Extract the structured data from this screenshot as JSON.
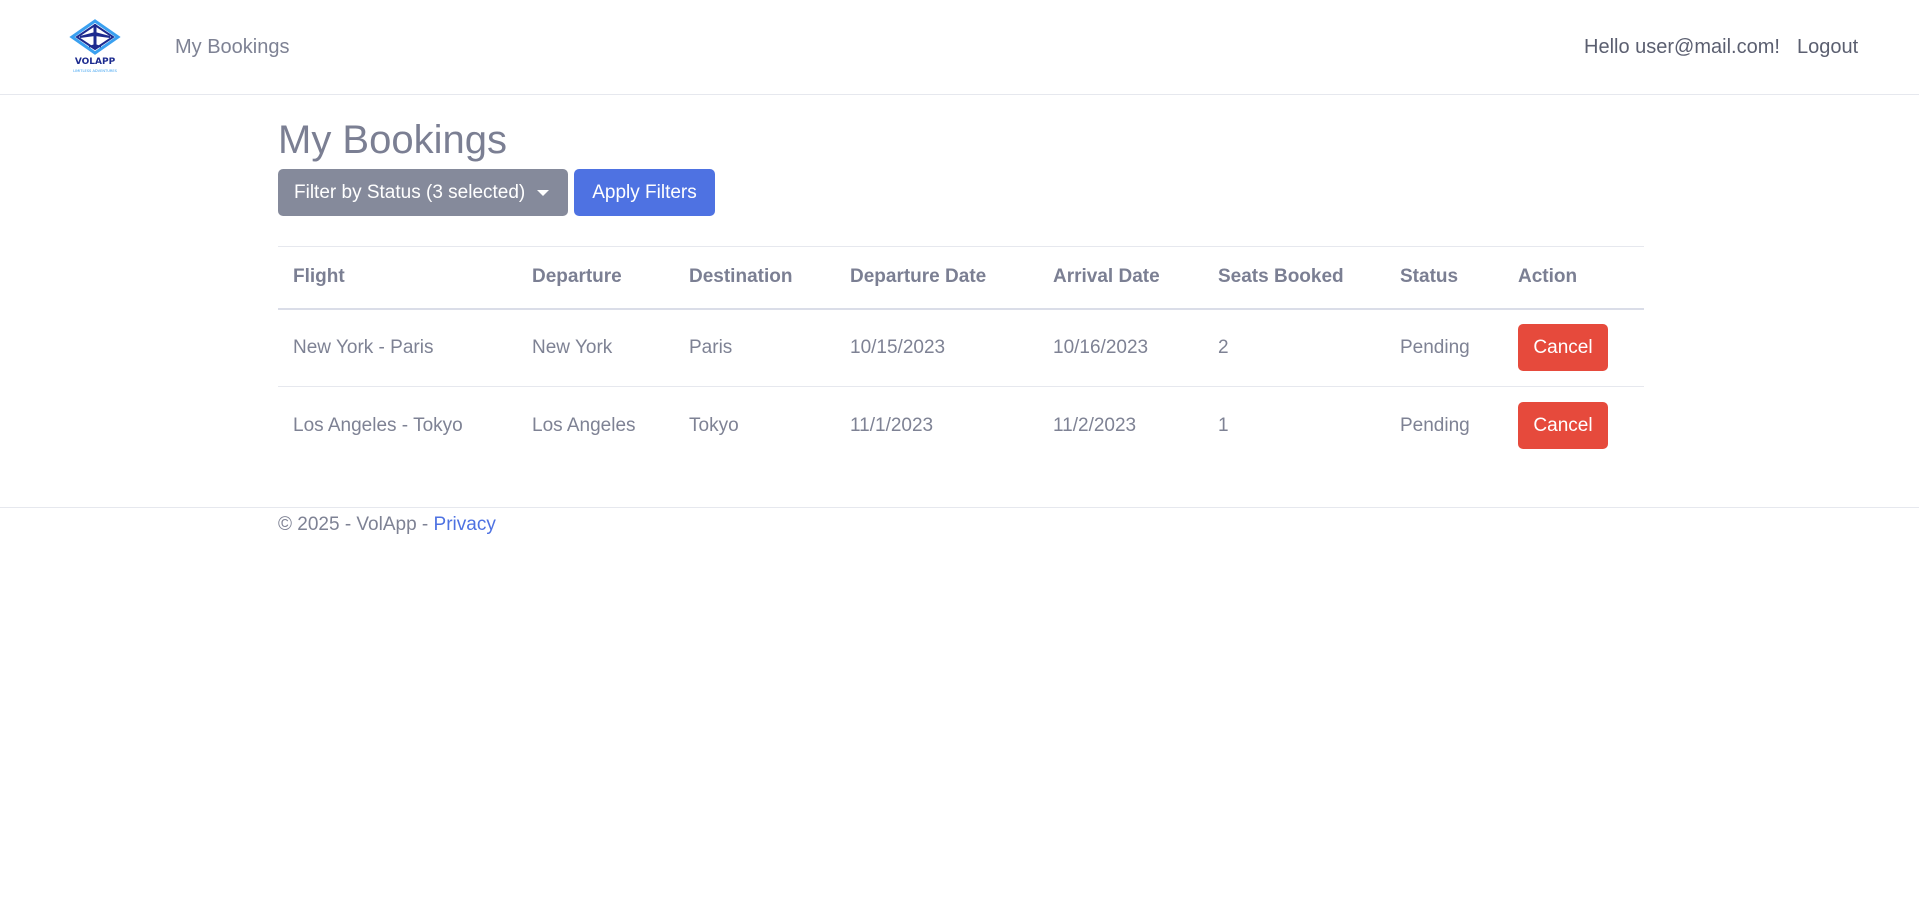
{
  "header": {
    "logo_text": "VOLAPP",
    "logo_tagline": "LIMITLESS ADVENTURES",
    "nav_my_bookings": "My Bookings",
    "greeting": "Hello user@mail.com!",
    "logout": "Logout"
  },
  "main": {
    "title": "My Bookings",
    "filter_button": "Filter by Status (3 selected)",
    "apply_button": "Apply Filters",
    "columns": [
      "Flight",
      "Departure",
      "Destination",
      "Departure Date",
      "Arrival Date",
      "Seats Booked",
      "Status",
      "Action"
    ],
    "rows": [
      {
        "flight": "New York - Paris",
        "departure": "New York",
        "destination": "Paris",
        "departure_date": "10/15/2023",
        "arrival_date": "10/16/2023",
        "seats": "2",
        "status": "Pending",
        "action": "Cancel"
      },
      {
        "flight": "Los Angeles - Tokyo",
        "departure": "Los Angeles",
        "destination": "Tokyo",
        "departure_date": "11/1/2023",
        "arrival_date": "11/2/2023",
        "seats": "1",
        "status": "Pending",
        "action": "Cancel"
      }
    ]
  },
  "footer": {
    "copyright": "© 2025 - VolApp - ",
    "privacy": "Privacy"
  },
  "colors": {
    "primary": "#4e72e2",
    "danger": "#e64a3c",
    "secondary": "#858a9b",
    "logo_dark": "#1d2b8f",
    "logo_light": "#3aa0f0"
  }
}
